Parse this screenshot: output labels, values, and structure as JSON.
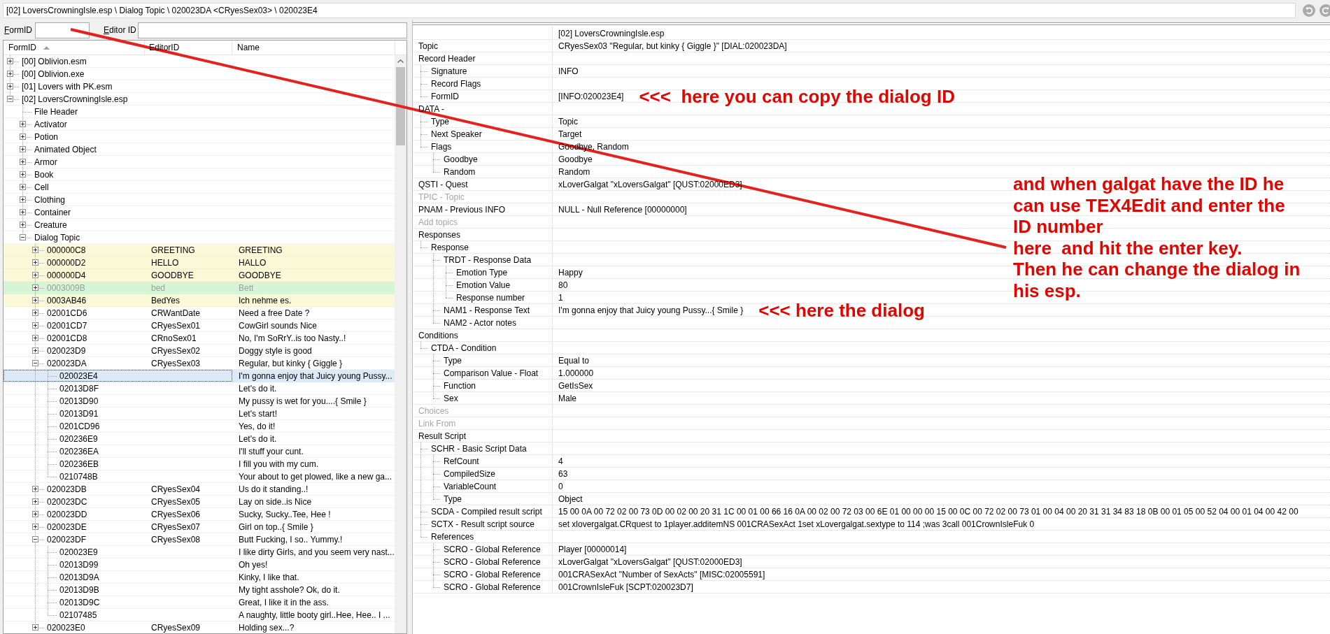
{
  "path_bar": {
    "text": "[02] LoversCrowningIsle.esp \\ Dialog Topic \\ 020023DA <CRyesSex03> \\ 020023E4"
  },
  "filter": {
    "form_id_label": "FormID",
    "editor_id_label": "Editor ID"
  },
  "tree": {
    "columns": [
      {
        "label": "FormID",
        "sorted": true
      },
      {
        "label": "EditorID",
        "sorted": false
      },
      {
        "label": "Name",
        "sorted": false
      }
    ],
    "items": [
      {
        "form_id": "[00] Oblivion.esm",
        "expanded": false,
        "selected": false
      },
      {
        "form_id": "[00] Oblivion.exe",
        "expanded": false,
        "selected": false
      },
      {
        "form_id": "[01] Lovers with PK.esm",
        "expanded": false,
        "selected": false
      },
      {
        "form_id": "[02] LoversCrowningIsle.esp",
        "expanded": true,
        "selected": false,
        "children": [
          {
            "form_id": "File Header",
            "selected": false
          },
          {
            "form_id": "Activator",
            "expanded": false,
            "selected": false
          },
          {
            "form_id": "Potion",
            "expanded": false,
            "selected": false
          },
          {
            "form_id": "Animated Object",
            "expanded": false,
            "selected": false
          },
          {
            "form_id": "Armor",
            "expanded": false,
            "selected": false
          },
          {
            "form_id": "Book",
            "expanded": false,
            "selected": false
          },
          {
            "form_id": "Cell",
            "expanded": false,
            "selected": false
          },
          {
            "form_id": "Clothing",
            "expanded": false,
            "selected": false
          },
          {
            "form_id": "Container",
            "expanded": false,
            "selected": false
          },
          {
            "form_id": "Creature",
            "expanded": false,
            "selected": false
          },
          {
            "form_id": "Dialog Topic",
            "expanded": true,
            "selected": false,
            "children": [
              {
                "form_id": "000000C8",
                "editor_id": "GREETING",
                "name": "GREETING",
                "expanded": false,
                "selected": false,
                "greyed": false,
                "color": "#fbf9d8"
              },
              {
                "form_id": "000000D2",
                "editor_id": "HELLO",
                "name": "HALLO",
                "expanded": false,
                "selected": false,
                "greyed": false,
                "color": "#fbf9d8"
              },
              {
                "form_id": "000000D4",
                "editor_id": "GOODBYE",
                "name": "GOODBYE",
                "expanded": false,
                "selected": false,
                "greyed": false,
                "color": "#fbf9d8"
              },
              {
                "form_id": "0003009B",
                "editor_id": "bed",
                "name": "Bett",
                "expanded": false,
                "selected": false,
                "greyed": true,
                "color": "#d6f5d6"
              },
              {
                "form_id": "0003AB46",
                "editor_id": "BedYes",
                "name": "Ich nehme es.",
                "expanded": false,
                "selected": false,
                "greyed": false,
                "color": "#fbf9d8"
              },
              {
                "form_id": "02001CD6",
                "editor_id": "CRWantDate",
                "name": "Need a free Date ?",
                "expanded": false,
                "selected": false,
                "greyed": false
              },
              {
                "form_id": "02001CD7",
                "editor_id": "CRyesSex01",
                "name": "CowGirl sounds Nice",
                "expanded": false,
                "selected": false,
                "greyed": false
              },
              {
                "form_id": "02001CD8",
                "editor_id": "CRnoSex01",
                "name": "No, I'm SoRrY..is too Nasty..!",
                "expanded": false,
                "selected": false,
                "greyed": false
              },
              {
                "form_id": "020023D9",
                "editor_id": "CRyesSex02",
                "name": "Doggy style is good",
                "expanded": false,
                "selected": false,
                "greyed": false
              },
              {
                "form_id": "020023DA",
                "editor_id": "CRyesSex03",
                "name": "Regular, but kinky { Giggle }",
                "expanded": true,
                "selected": false,
                "greyed": false,
                "children": [
                  {
                    "form_id": "020023E4",
                    "name": "I'm gonna enjoy that Juicy young Pussy...",
                    "selected": true
                  },
                  {
                    "form_id": "02013D8F",
                    "name": "Let's do it.",
                    "selected": false
                  },
                  {
                    "form_id": "02013D90",
                    "name": "My pussy is wet for you....{ Smile }",
                    "selected": false
                  },
                  {
                    "form_id": "02013D91",
                    "name": "Let's start!",
                    "selected": false
                  },
                  {
                    "form_id": "0201CD96",
                    "name": "Yes, do it!",
                    "selected": false
                  },
                  {
                    "form_id": "020236E9",
                    "name": "Let's do it.",
                    "selected": false
                  },
                  {
                    "form_id": "020236EA",
                    "name": "I'll stuff your cunt.",
                    "selected": false
                  },
                  {
                    "form_id": "020236EB",
                    "name": "I fill you with my cum.",
                    "selected": false
                  },
                  {
                    "form_id": "0210748B",
                    "name": "Your about to get plowed, like a new ga...",
                    "selected": false
                  }
                ]
              },
              {
                "form_id": "020023DB",
                "editor_id": "CRyesSex04",
                "name": "Us do it standing..!",
                "expanded": false,
                "selected": false,
                "greyed": false
              },
              {
                "form_id": "020023DC",
                "editor_id": "CRyesSex05",
                "name": "Lay on side..is Nice",
                "expanded": false,
                "selected": false,
                "greyed": false
              },
              {
                "form_id": "020023DD",
                "editor_id": "CRyesSex06",
                "name": "Sucky, Sucky..Tee, Hee !",
                "expanded": false,
                "selected": false,
                "greyed": false
              },
              {
                "form_id": "020023DE",
                "editor_id": "CRyesSex07",
                "name": "Girl on top..{ Smile }",
                "expanded": false,
                "selected": false,
                "greyed": false
              },
              {
                "form_id": "020023DF",
                "editor_id": "CRyesSex08",
                "name": "Butt Fucking, I so.. Yummy.!",
                "expanded": true,
                "selected": false,
                "greyed": false,
                "children": [
                  {
                    "form_id": "020023E9",
                    "name": "I like dirty Girls, and you seem very nast...",
                    "selected": false
                  },
                  {
                    "form_id": "02013D99",
                    "name": "Oh yes!",
                    "selected": false
                  },
                  {
                    "form_id": "02013D9A",
                    "name": "Kinky, I like that.",
                    "selected": false
                  },
                  {
                    "form_id": "02013D9B",
                    "name": "My tight asshole? Ok, do it.",
                    "selected": false
                  },
                  {
                    "form_id": "02013D9C",
                    "name": "Great, I like it in the ass.",
                    "selected": false
                  },
                  {
                    "form_id": "02107485",
                    "name": "A naughty, little booty girl..Hee, Hee.. I ...",
                    "selected": false
                  }
                ]
              },
              {
                "form_id": "020023E0",
                "editor_id": "CRyesSex09",
                "name": "Holding sex...?",
                "expanded": false,
                "selected": false,
                "greyed": false
              }
            ]
          }
        ]
      }
    ]
  },
  "record_view": {
    "header": "[02] LoversCrowningIsle.esp",
    "rows": [
      {
        "label": "Topic",
        "value": "CRyesSex03 \"Regular, but kinky { Giggle }\" [DIAL:020023DA]",
        "greyed": false
      },
      {
        "label": "Record Header",
        "greyed": false,
        "children": [
          {
            "label": "Signature",
            "value": "INFO"
          },
          {
            "label": "Record Flags"
          },
          {
            "label": "FormID",
            "value": "[INFO:020023E4]",
            "note": "<<<  here you can copy the dialog ID"
          }
        ]
      },
      {
        "label": "DATA -",
        "greyed": false,
        "children": [
          {
            "label": "Type",
            "value": "Topic"
          },
          {
            "label": "Next Speaker",
            "value": "Target"
          },
          {
            "label": "Flags",
            "value": "Goodbye, Random",
            "children": [
              {
                "label": "Goodbye",
                "value": "Goodbye"
              },
              {
                "label": "Random",
                "value": "Random"
              }
            ]
          }
        ]
      },
      {
        "label": "QSTI - Quest",
        "value": "xLoverGalgat \"xLoversGalgat\" [QUST:02000ED3]",
        "greyed": false
      },
      {
        "label": "TPIC - Topic",
        "greyed": true
      },
      {
        "label": "PNAM - Previous INFO",
        "value": "NULL - Null Reference [00000000]",
        "greyed": false
      },
      {
        "label": "Add topics",
        "greyed": true
      },
      {
        "label": "Responses",
        "greyed": false,
        "children": [
          {
            "label": "Response",
            "children": [
              {
                "label": "TRDT - Response Data",
                "children": [
                  {
                    "label": "Emotion Type",
                    "value": "Happy"
                  },
                  {
                    "label": "Emotion Value",
                    "value": "80"
                  },
                  {
                    "label": "Response number",
                    "value": "1"
                  }
                ]
              },
              {
                "label": "NAM1 - Response Text",
                "value": "I'm gonna enjoy that Juicy young Pussy...{ Smile }",
                "note": "<<< here the dialog"
              },
              {
                "label": "NAM2 - Actor notes"
              }
            ]
          }
        ]
      },
      {
        "label": "Conditions",
        "greyed": false,
        "children": [
          {
            "label": "CTDA - Condition",
            "children": [
              {
                "label": "Type",
                "value": "Equal to"
              },
              {
                "label": "Comparison Value - Float",
                "value": "1.000000"
              },
              {
                "label": "Function",
                "value": "GetIsSex"
              },
              {
                "label": "Sex",
                "value": "Male"
              }
            ]
          }
        ]
      },
      {
        "label": "Choices",
        "greyed": true
      },
      {
        "label": "Link From",
        "greyed": true
      },
      {
        "label": "Result Script",
        "greyed": false,
        "children": [
          {
            "label": "SCHR - Basic Script Data",
            "children": [
              {
                "label": "RefCount",
                "value": "4"
              },
              {
                "label": "CompiledSize",
                "value": "63"
              },
              {
                "label": "VariableCount",
                "value": "0"
              },
              {
                "label": "Type",
                "value": "Object"
              }
            ]
          },
          {
            "label": "SCDA - Compiled result script",
            "value": "15 00 0A 00 72 02 00 73 0D 00 02 00 20 31 1C 00 01 00 66 16 0A 00 02 00 72 03 00 6E 01 00 00 00 15 00 0C 00 72 02 00 73 01 00 04 00 20 31 31 34 83 18 0B 00 01 05 00 52 04 00 01 04 00 42 00"
          },
          {
            "label": "SCTX - Result script source",
            "value": "set xlovergalgat.CRquest to 1player.additemNS 001CRASexAct 1set xLovergalgat.sextype to 114 ;was 3call 001CrownIsleFuk 0"
          },
          {
            "label": "References",
            "children": [
              {
                "label": "SCRO - Global Reference",
                "value": "Player [00000014]"
              },
              {
                "label": "SCRO - Global Reference",
                "value": "xLoverGalgat \"xLoversGalgat\" [QUST:02000ED3]"
              },
              {
                "label": "SCRO - Global Reference",
                "value": "001CRASexAct \"Number of SexActs\" [MISC:02005591]"
              },
              {
                "label": "SCRO - Global Reference",
                "value": "001CrownIsleFuk [SCPT:020023D7]"
              }
            ]
          }
        ]
      }
    ]
  },
  "callout": {
    "lines": [
      "and when galgat have the ID he",
      "can use TEX4Edit and enter the",
      "ID number",
      "here  and hit the enter key.",
      "Then he can change the dialog in",
      "his esp."
    ]
  }
}
